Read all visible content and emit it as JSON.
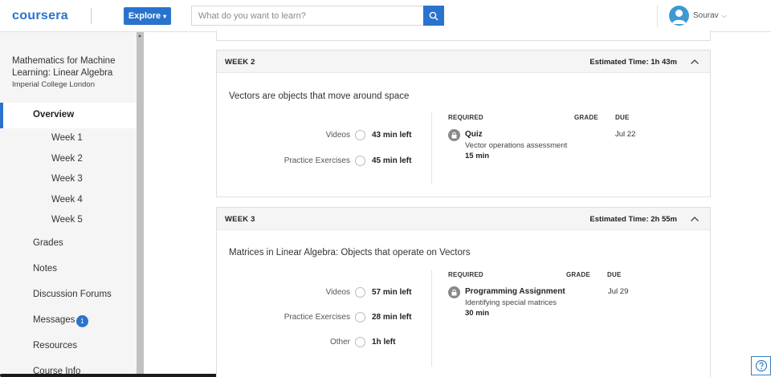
{
  "header": {
    "logo": "coursera",
    "explore_label": "Explore",
    "search_placeholder": "What do you want to learn?",
    "user_name": "Sourav",
    "accent_color": "#2a73cc"
  },
  "sidebar": {
    "course_title": "Mathematics for Machine Learning: Linear Algebra",
    "course_org": "Imperial College London",
    "overview_label": "Overview",
    "weeks": [
      "Week 1",
      "Week 2",
      "Week 3",
      "Week 4",
      "Week 5"
    ],
    "items": {
      "grades": "Grades",
      "notes": "Notes",
      "forums": "Discussion Forums",
      "messages": "Messages",
      "messages_badge": "1",
      "resources": "Resources",
      "course_info": "Course Info"
    }
  },
  "weeks": [
    {
      "label": "WEEK 2",
      "estimated": "Estimated Time: 1h 43m",
      "description": "Vectors are objects that move around space",
      "items": [
        {
          "label": "Videos",
          "time": "43 min left"
        },
        {
          "label": "Practice Exercises",
          "time": "45 min left"
        }
      ],
      "headers": {
        "required": "REQUIRED",
        "grade": "GRADE",
        "due": "DUE"
      },
      "assessment": {
        "title": "Quiz",
        "subtitle": "Vector operations assessment",
        "length": "15 min",
        "due": "Jul 22"
      }
    },
    {
      "label": "WEEK 3",
      "estimated": "Estimated Time: 2h 55m",
      "description": "Matrices in Linear Algebra: Objects that operate on Vectors",
      "items": [
        {
          "label": "Videos",
          "time": "57 min left"
        },
        {
          "label": "Practice Exercises",
          "time": "28 min left"
        },
        {
          "label": "Other",
          "time": "1h left"
        }
      ],
      "headers": {
        "required": "REQUIRED",
        "grade": "GRADE",
        "due": "DUE"
      },
      "assessment": {
        "title": "Programming Assignment",
        "subtitle": "Identifying special matrices",
        "length": "30 min",
        "due": "Jul 29"
      }
    }
  ],
  "icons": {
    "search": "search-icon",
    "lock": "lock-icon",
    "chevron_up": "chevron-up-icon",
    "help": "help-icon"
  }
}
